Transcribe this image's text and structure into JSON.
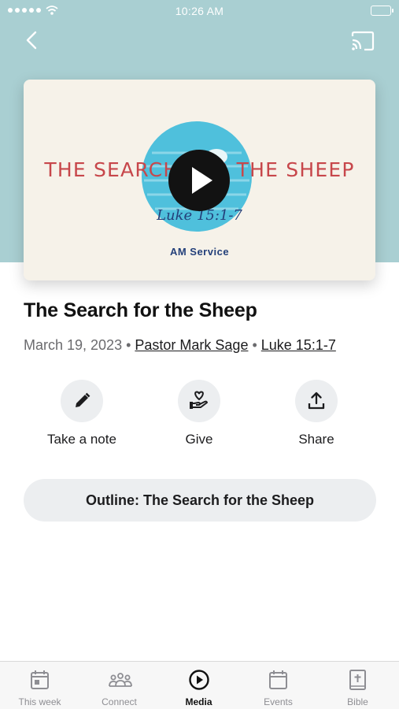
{
  "status_bar": {
    "time": "10:26 AM"
  },
  "artwork": {
    "title": "THE SEARCH FOR THE SHEEP",
    "verse": "Luke 15:1-7",
    "service": "AM Service"
  },
  "sermon": {
    "title": "The Search for the Sheep",
    "date": "March 19, 2023",
    "speaker": "Pastor Mark Sage",
    "scripture": "Luke 15:1-7"
  },
  "actions": [
    {
      "label": "Take a note",
      "icon": "pencil-icon"
    },
    {
      "label": "Give",
      "icon": "hand-heart-icon"
    },
    {
      "label": "Share",
      "icon": "share-icon"
    }
  ],
  "outline_button": {
    "label": "Outline: The Search for the Sheep"
  },
  "tabs": [
    {
      "label": "This week",
      "icon": "calendar-day-icon"
    },
    {
      "label": "Connect",
      "icon": "people-icon"
    },
    {
      "label": "Media",
      "icon": "play-circle-icon",
      "active": true
    },
    {
      "label": "Events",
      "icon": "calendar-icon"
    },
    {
      "label": "Bible",
      "icon": "bible-icon"
    }
  ],
  "colors": {
    "header_bg": "#a9cfd2",
    "artwork_title": "#c7474b",
    "artwork_text": "#24407a",
    "artwork_blob": "#4fc0dc"
  }
}
